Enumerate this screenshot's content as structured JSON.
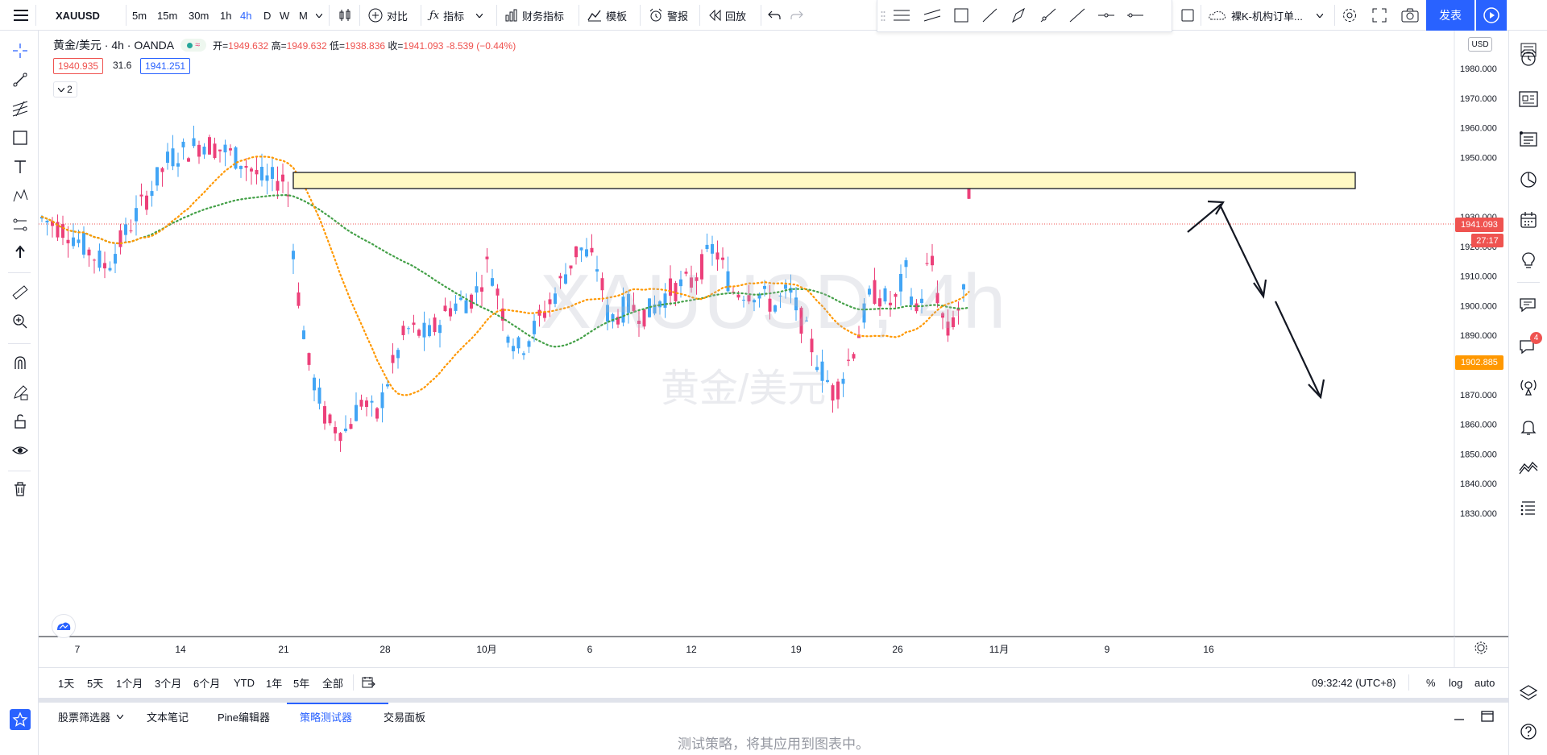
{
  "header": {
    "symbol": "XAUUSD",
    "timeframes": [
      "5m",
      "15m",
      "30m",
      "1h",
      "4h",
      "D",
      "W",
      "M"
    ],
    "active_timeframe": "4h",
    "compare_label": "对比",
    "indicators_label": "指标",
    "financials_label": "财务指标",
    "templates_label": "模板",
    "alert_label": "警报",
    "replay_label": "回放",
    "layout_label": "裸K-机构订单...",
    "publish_label": "发表"
  },
  "legend": {
    "title": "黄金/美元 · 4h · OANDA",
    "open_label": "开=",
    "open": "1949.632",
    "high_label": "高=",
    "high": "1949.632",
    "low_label": "低=",
    "low": "1938.836",
    "close_label": "收=",
    "close": "1941.093",
    "change": "-8.539 (−0.44%)",
    "bid": "1940.935",
    "spread": "31.6",
    "ask": "1941.251",
    "collapse_count": "2"
  },
  "watermark": {
    "symbol_line": "XAUUSD, 4h",
    "name_line": "黄金/美元"
  },
  "price_axis": {
    "currency": "USD",
    "labels": [
      "1980.000",
      "1970.000",
      "1960.000",
      "1950.000",
      "1930.000",
      "1920.000",
      "1910.000",
      "1900.000",
      "1890.000",
      "1880.000",
      "1870.000",
      "1860.000",
      "1850.000",
      "1840.000",
      "1830.000"
    ],
    "last_price": "1941.093",
    "countdown": "27:17",
    "ma_price": "1902.885"
  },
  "time_axis": {
    "labels": [
      "7",
      "14",
      "21",
      "28",
      "10月",
      "6",
      "12",
      "19",
      "26",
      "11月",
      "9",
      "16"
    ]
  },
  "bottom_bar": {
    "ranges": [
      "1天",
      "5天",
      "1个月",
      "3个月",
      "6个月",
      "YTD",
      "1年",
      "5年",
      "全部"
    ],
    "clock": "09:32:42 (UTC+8)",
    "percent": "%",
    "log": "log",
    "auto": "auto"
  },
  "panel": {
    "tabs": [
      "股票筛选器",
      "文本笔记",
      "Pine编辑器",
      "策略测试器",
      "交易面板"
    ],
    "active_tab": "策略测试器",
    "message": "测试策略，将其应用到图表中。"
  },
  "colors": {
    "accent": "#2962ff",
    "up": "#42a5f5",
    "down": "#ec407a",
    "ma_fast": "#ff9800",
    "ma_slow": "#43a047",
    "zone_fill": "#fff9c4"
  }
}
